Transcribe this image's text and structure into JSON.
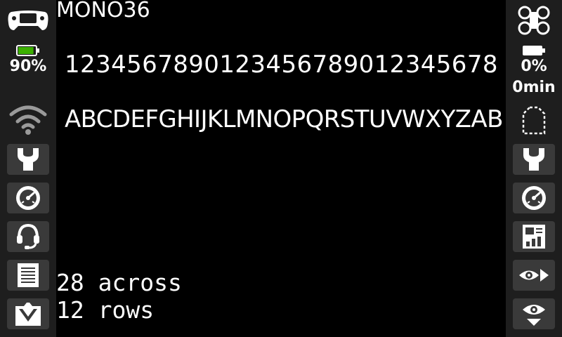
{
  "screen": {
    "title": "MONO36",
    "digits_line": "1234567890123456789012345678",
    "letters_line": "ABCDEFGHIJKLMNOPQRSTUVWXYZAB",
    "across_text": "28 across",
    "rows_text": "12 rows"
  },
  "left_sidebar": {
    "radio_battery_percent": "90%",
    "radio_battery_fill": 0.9,
    "icons": [
      "gamepad-icon",
      "battery-icon",
      "wifi-signal-icon",
      "wrench-icon",
      "gauge-icon",
      "headset-icon",
      "document-icon",
      "folder-icon"
    ]
  },
  "right_sidebar": {
    "model_battery_percent": "0%",
    "model_battery_fill": 0.0,
    "flight_time": "0min",
    "icons": [
      "drone-icon",
      "battery-icon",
      "dashed-frame-icon",
      "wrench-icon",
      "gauge-icon",
      "telemetry-screen-icon",
      "eye-arrow-icon",
      "eye-down-icon"
    ]
  },
  "colors": {
    "background": "#000000",
    "sidebar": "#1e1e1e",
    "button": "#3a3a3a",
    "battery_green": "#3cb000",
    "text": "#ffffff",
    "wifi_inactive": "#9a9a9a"
  }
}
